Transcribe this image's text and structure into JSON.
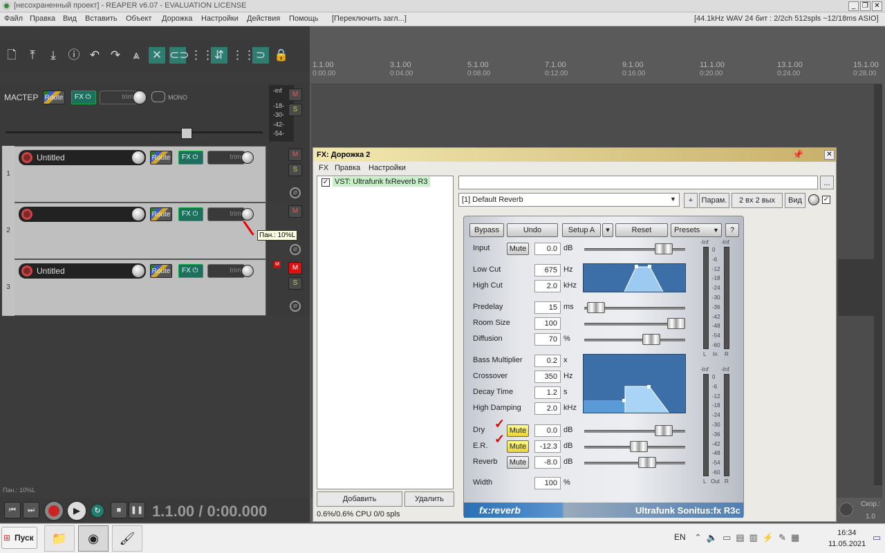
{
  "window": {
    "title": "[несохраненный проект] - REAPER v6.07 - EVALUATION LICENSE"
  },
  "menu": [
    "Файл",
    "Правка",
    "Вид",
    "Вставить",
    "Объект",
    "Дорожка",
    "Настройки",
    "Действия",
    "Помощь",
    "[Переключить загл...]"
  ],
  "status_info": "[44.1kHz WAV 24 бит : 2/2ch 512spls ~12/18ms ASIO]",
  "master": {
    "label": "МАСТЕР",
    "route": "Route",
    "fx": "FX",
    "trim": "trim",
    "mono": "MONO",
    "meter_scale": [
      "-inf",
      "-18-",
      "-30-",
      "-42-",
      "-54-"
    ],
    "m": "M",
    "s": "S"
  },
  "tracks": [
    {
      "num": "1",
      "name": "Untitled",
      "route": "Route",
      "fx": "FX",
      "trim": "trim",
      "m": "M",
      "s": "S"
    },
    {
      "num": "2",
      "name": "",
      "route": "Route",
      "fx": "FX",
      "trim": "trim",
      "m": "M",
      "s": "S"
    },
    {
      "num": "3",
      "name": "Untitled",
      "route": "Route",
      "fx": "FX",
      "trim": "trim",
      "m": "M",
      "s": "S"
    }
  ],
  "pan_tooltip": "Пан.: 10%L",
  "status_left": "Пан.: 10%L",
  "transport": {
    "time": "1.1.00 / 0:00.000"
  },
  "ruler": [
    {
      "bar": "1.1.00",
      "time": "0:00.00"
    },
    {
      "bar": "3.1.00",
      "time": "0:04.00"
    },
    {
      "bar": "5.1.00",
      "time": "0:08.00"
    },
    {
      "bar": "7.1.00",
      "time": "0:12.00"
    },
    {
      "bar": "9.1.00",
      "time": "0:16.00"
    },
    {
      "bar": "11.1.00",
      "time": "0:20.00"
    },
    {
      "bar": "13.1.00",
      "time": "0:24.00"
    },
    {
      "bar": "15.1.00",
      "time": "0:28.00"
    }
  ],
  "fx": {
    "title": "FX: Дорожка 2",
    "menu": [
      "FX",
      "Правка",
      "Настройки"
    ],
    "plugin_item": "VST: Ultrafunk fxReverb R3",
    "preset": "[1] Default Reverb",
    "plus": "+",
    "param": "Парам.",
    "io": "2 вх 2 вых",
    "view": "Вид",
    "add": "Добавить",
    "delete": "Удалить",
    "cpu": "0.6%/0.6% CPU 0/0 spls",
    "browse": "..."
  },
  "plugin": {
    "buttons": {
      "bypass": "Bypass",
      "undo": "Undo",
      "setup": "Setup A",
      "reset": "Reset",
      "presets": "Presets",
      "help": "?"
    },
    "mute": "Mute",
    "params": [
      {
        "label": "Input",
        "value": "0.0",
        "unit": "dB"
      },
      {
        "label": "Low Cut",
        "value": "675",
        "unit": "Hz"
      },
      {
        "label": "High Cut",
        "value": "2.0",
        "unit": "kHz"
      },
      {
        "label": "Predelay",
        "value": "15",
        "unit": "ms"
      },
      {
        "label": "Room Size",
        "value": "100",
        "unit": ""
      },
      {
        "label": "Diffusion",
        "value": "70",
        "unit": "%"
      },
      {
        "label": "Bass Multiplier",
        "value": "0.2",
        "unit": "x"
      },
      {
        "label": "Crossover",
        "value": "350",
        "unit": "Hz"
      },
      {
        "label": "Decay Time",
        "value": "1.2",
        "unit": "s"
      },
      {
        "label": "High Damping",
        "value": "2.0",
        "unit": "kHz"
      },
      {
        "label": "Dry",
        "value": "0.0",
        "unit": "dB"
      },
      {
        "label": "E.R.",
        "value": "-12.3",
        "unit": "dB"
      },
      {
        "label": "Reverb",
        "value": "-8.0",
        "unit": "dB"
      },
      {
        "label": "Width",
        "value": "100",
        "unit": "%"
      }
    ],
    "meter_scale": [
      "0",
      "-6",
      "-12",
      "-18",
      "-24",
      "-30",
      "-36",
      "-42",
      "-48",
      "-54",
      "-60"
    ],
    "meter_top": "-Inf",
    "meter_in_labels": [
      "L",
      "In",
      "R"
    ],
    "meter_out_labels": [
      "L",
      "Out",
      "R"
    ],
    "footer_left": "fx:reverb",
    "footer_right": "Ultrafunk Sonitus:fx R3c"
  },
  "taskbar": {
    "start": "Пуск",
    "lang": "EN",
    "time": "16:34",
    "date": "11.05.2021"
  },
  "right_panel": {
    "label": "Скор.:",
    "value": "1.0"
  }
}
